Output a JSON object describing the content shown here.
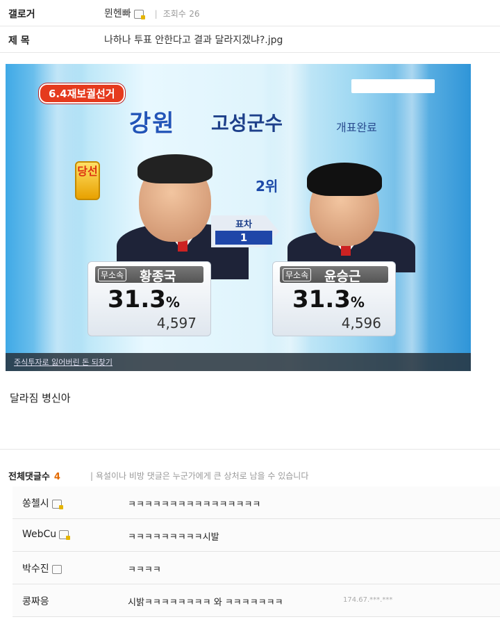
{
  "post": {
    "author_label": "갤로거",
    "author_name": "뮌헨빠",
    "views_label": "조회수",
    "views": "26",
    "title_label": "제 목",
    "title": "나하나 투표 안한다고 결과 달라지겠냐?.jpg",
    "body": "달라짐 병신아"
  },
  "image": {
    "badge": "6.4재보궐선거",
    "region": "강원",
    "office": "고성군수",
    "count_status": "개표완료",
    "winner_mark": "당선",
    "second_mark": "2위",
    "diff_label": "표차",
    "diff_value": "1",
    "candidate1": {
      "party": "무소속",
      "name": "황종국",
      "pct": "31.3",
      "pct_unit": "%",
      "votes": "4,597"
    },
    "candidate2": {
      "party": "무소속",
      "name": "윤승근",
      "pct": "31.3",
      "pct_unit": "%",
      "votes": "4,596"
    },
    "ticker": "주식투자로 잃어버린 돈 되찾기"
  },
  "comments": {
    "label": "전체댓글수",
    "count": "4",
    "notice": "| 욕설이나 비방 댓글은 누군가에게 큰 상처로 남을 수 있습니다",
    "items": [
      {
        "nick": "쏭첼시",
        "text": "ㅋㅋㅋㅋㅋㅋㅋㅋㅋㅋㅋㅋㅋㅋㅋㅋ",
        "ip": ""
      },
      {
        "nick": "WebCu",
        "text": "ㅋㅋㅋㅋㅋㅋㅋㅋㅋ시발",
        "ip": ""
      },
      {
        "nick": "박수진",
        "text": "ㅋㅋㅋㅋ",
        "ip": ""
      },
      {
        "nick": "콩짜응",
        "text": "시밝ㅋㅋㅋㅋㅋㅋㅋㅋ 와 ㅋㅋㅋㅋㅋㅋㅋ",
        "ip": "174.67.***.***"
      }
    ]
  }
}
